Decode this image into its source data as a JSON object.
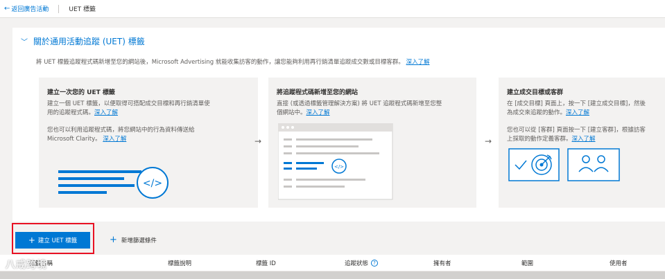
{
  "topbar": {
    "back_label": "返回廣告活動",
    "crumb": "UET 標籤"
  },
  "section": {
    "title": "關於通用活動追蹤 (UET) 標籤",
    "intro_text": "將 UET 標籤追蹤程式碼新增至您的網站後，Microsoft Advertising 就能收集訪客的動作，讓您能夠利用再行銷清單追蹤成交數或目標客群。",
    "intro_link": "深入了解"
  },
  "cards": [
    {
      "title": "建立一次您的 UET 標籤",
      "p1_line1": "建立一個 UET 標籤，以便取得可搭配成交目標和再行銷清單使",
      "p1_line2": "用的追蹤程式碼。",
      "p1_link": "深入了解",
      "p2_line1": "您也可以利用追蹤程式碼，將您網站中的行為資料傳送給",
      "p2_line2": "Microsoft Clarity。",
      "p2_link": "深入了解"
    },
    {
      "title": "將追蹤程式碼新增至您的網站",
      "p1_line1": "直接 (或透過標籤管理解決方案) 將 UET 追蹤程式碼新增至您整",
      "p1_line2": "個網站中。",
      "p1_link": "深入了解"
    },
    {
      "title": "建立成交目標或客群",
      "p1_line1": "在 [成交目標] 頁面上，按一下 [建立成交目標]，然後",
      "p1_line2": "為成交來追蹤的動作。",
      "p1_link": "深入了解",
      "p2_line1": "您也可以從 [客群] 頁面按一下 [建立客群]，根據訪客",
      "p2_line2": "上採取的動作定義客群。",
      "p2_link": "深入了解"
    }
  ],
  "toolbar": {
    "create_label": "建立 UET 標籤",
    "filter_label": "新增篩選條件"
  },
  "table": {
    "columns": [
      "標籤名稱",
      "標籤說明",
      "標籤 ID",
      "追蹤狀態",
      "擁有者",
      "範圍",
      "使用者"
    ]
  },
  "watermark": "八戒跨境",
  "colors": {
    "accent": "#0078d4",
    "highlight": "#e81123",
    "card_bg": "#f3f2f1"
  }
}
